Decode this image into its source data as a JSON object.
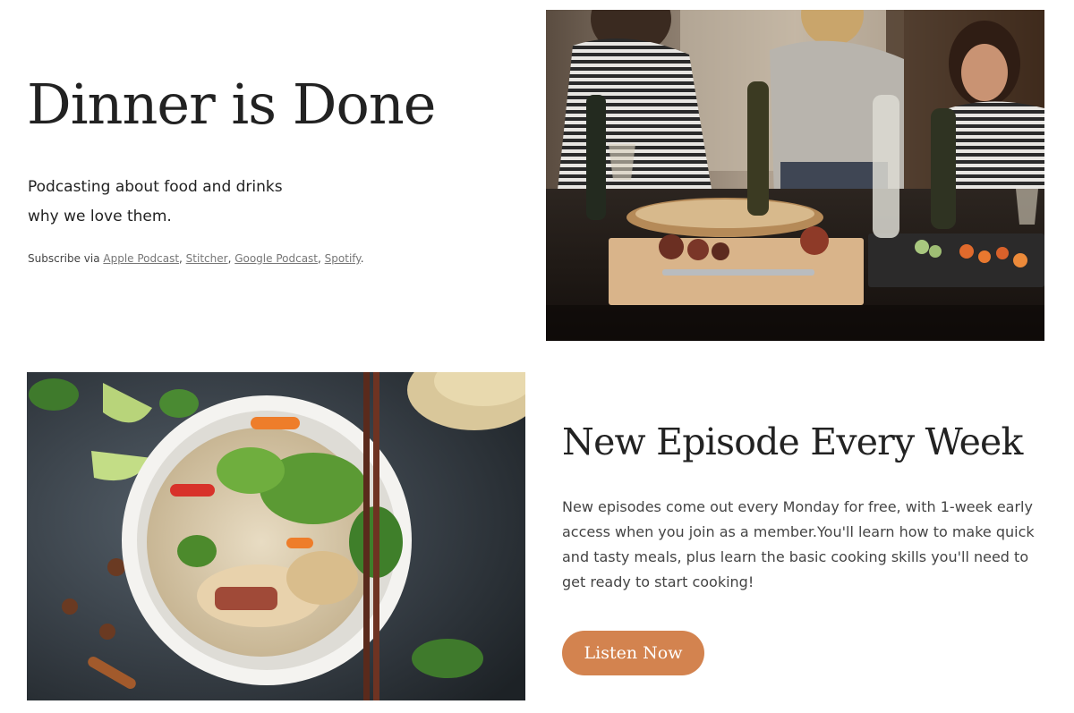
{
  "hero": {
    "title": "Dinner is Done",
    "tagline_line1": "Podcasting about food and drinks",
    "tagline_line2": "why we love them.",
    "subscribe_prefix": "Subscribe via ",
    "links": [
      "Apple Podcast",
      "Stitcher",
      "Google Podcast",
      "Spotify"
    ],
    "separator": ", ",
    "end": "."
  },
  "episode": {
    "title": "New Episode Every Week",
    "description": "New episodes come out every Monday for free, with 1-week early access when you join as a member.You'll learn how to make quick and tasty meals, plus learn the basic cooking skills you'll need to get ready to start cooking!",
    "button_label": "Listen Now"
  },
  "colors": {
    "accent": "#d3834f",
    "text": "#222222",
    "muted": "#444444"
  }
}
